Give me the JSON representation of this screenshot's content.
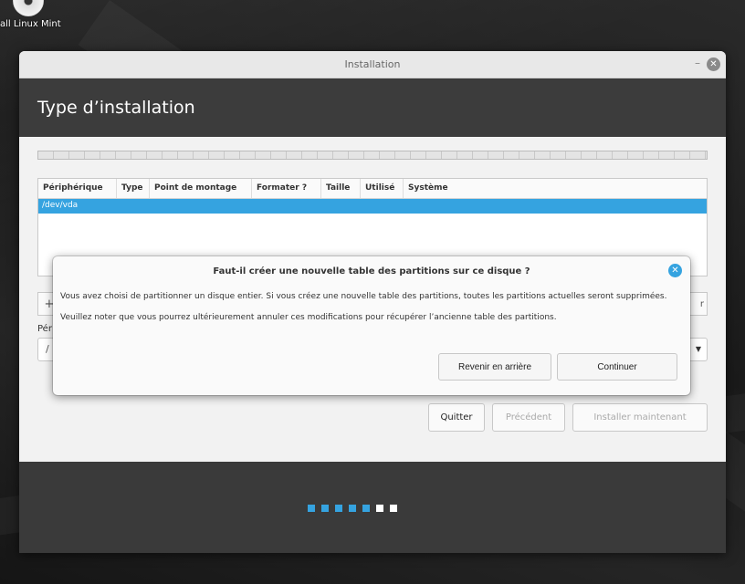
{
  "desktop": {
    "icon_label": "all Linux Mint"
  },
  "window": {
    "title": "Installation",
    "minimize_glyph": "–",
    "close_glyph": "✕",
    "heading": "Type d’installation"
  },
  "partition_table": {
    "columns": [
      "Périphérique",
      "Type",
      "Point de montage",
      "Formater ?",
      "Taille",
      "Utilisé",
      "Système"
    ],
    "rows": [
      "/dev/vda"
    ]
  },
  "tools": {
    "add_glyph": "+",
    "right_glyph": "r"
  },
  "bootloader": {
    "label": "Pér",
    "value": "/"
  },
  "nav": {
    "quit": "Quitter",
    "previous": "Précédent",
    "install": "Installer maintenant"
  },
  "progress": {
    "completed_steps": 5,
    "total_steps": 7
  },
  "dialog": {
    "title": "Faut-il créer une nouvelle table des partitions sur ce disque ?",
    "message1": "Vous avez choisi de partitionner un disque entier. Si vous créez une nouvelle table des partitions, toutes les partitions actuelles seront supprimées.",
    "message2": "Veuillez noter que vous pourrez ultérieurement annuler ces modifications pour récupérer l’ancienne table des partitions.",
    "back": "Revenir en arrière",
    "continue": "Continuer"
  },
  "colors": {
    "accent": "#35a3e0",
    "header_bg": "#3c3c3c",
    "footer_bg": "#3a3a3a"
  }
}
